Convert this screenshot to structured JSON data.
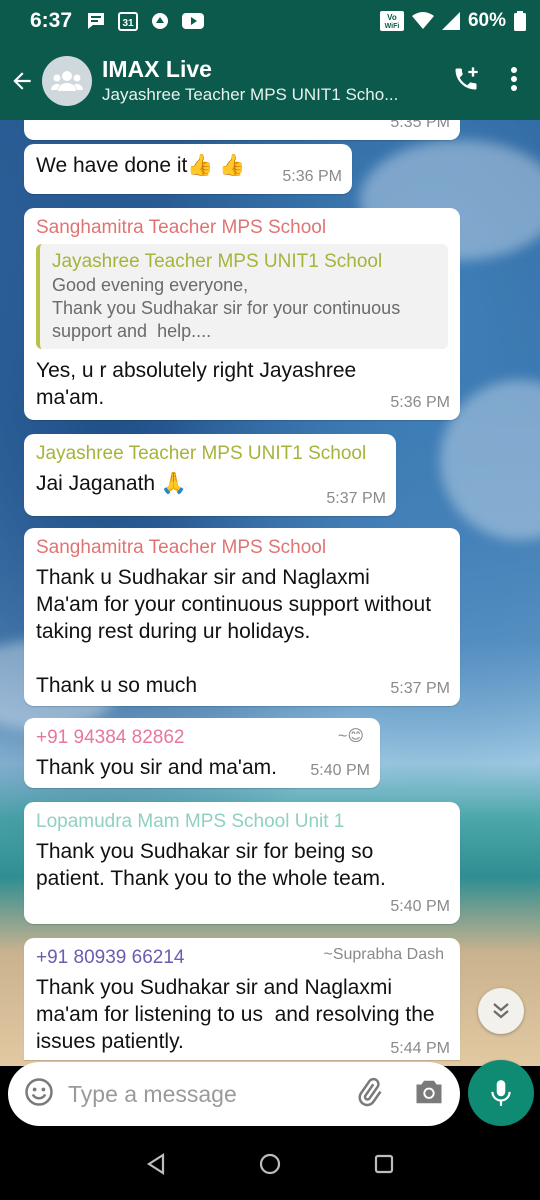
{
  "status_bar": {
    "time": "6:37",
    "battery": "60%",
    "icons": [
      "chat-notification-icon",
      "calendar-31-icon",
      "app-icon",
      "youtube-icon",
      "volte-wifi-icon",
      "wifi-icon",
      "signal-icon",
      "battery-icon"
    ],
    "calendar_day": "31",
    "vowifi_line1": "Vo",
    "vowifi_line2": "WiFi"
  },
  "header": {
    "title": "IMAX Live",
    "subtitle": "Jayashree Teacher MPS UNIT1 Scho...",
    "bg_color": "#0b5a4c"
  },
  "messages": [
    {
      "type": "partial",
      "time": "5:35 PM"
    },
    {
      "type": "text",
      "text": "We have done it👍 👍",
      "time": "5:36 PM"
    },
    {
      "type": "reply",
      "sender": "Sanghamitra Teacher MPS School",
      "sender_color": "#e07474",
      "quote_author": "Jayashree Teacher MPS UNIT1 School",
      "quote_text": "Good evening everyone,\nThank you Sudhakar sir for your continuous support and  help....",
      "text": "Yes, u r absolutely right Jayashree ma'am.",
      "time": "5:36 PM"
    },
    {
      "type": "text",
      "sender": "Jayashree Teacher MPS UNIT1 School",
      "sender_color": "#a7b33a",
      "text": "Jai Jaganath 🙏",
      "time": "5:37 PM"
    },
    {
      "type": "text",
      "sender": "Sanghamitra Teacher MPS School",
      "sender_color": "#e07474",
      "text": "Thank u Sudhakar sir and Naglaxmi Ma'am for your continuous support without taking rest during ur holidays.\n\nThank u so much",
      "time": "5:37 PM"
    },
    {
      "type": "text",
      "sender": "+91 94384 82862",
      "sender_color": "#e8779b",
      "pushname": "~😊",
      "text": "Thank you sir and ma'am.",
      "time": "5:40 PM"
    },
    {
      "type": "text",
      "sender": "Lopamudra Mam MPS School Unit 1",
      "sender_color": "#8fd0c3",
      "text": "Thank you Sudhakar sir for being so patient. Thank you to the whole team.",
      "time": "5:40 PM"
    },
    {
      "type": "text",
      "sender": "+91 80939 66214",
      "sender_color": "#6a5db0",
      "pushname": "~Suprabha Dash",
      "text": "Thank you Sudhakar sir and Naglaxmi ma'am for listening to us  and resolving the issues patiently.",
      "time": "5:44 PM"
    }
  ],
  "composer": {
    "placeholder": "Type a message"
  }
}
